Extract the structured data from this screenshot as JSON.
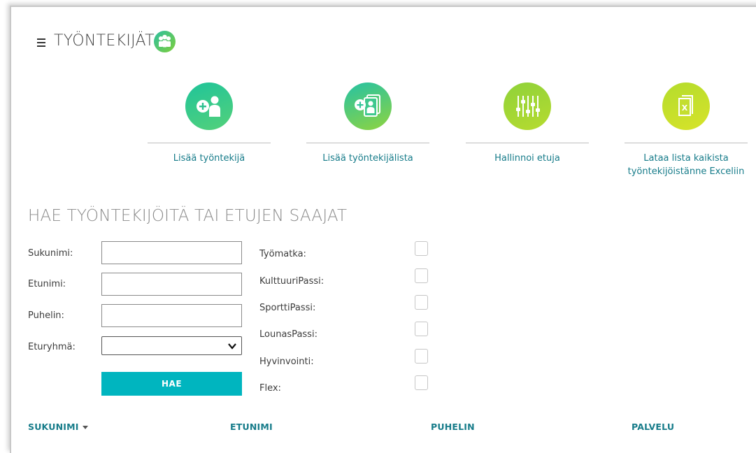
{
  "header": {
    "title": "TYÖNTEKIJÄT",
    "menu_icon": "hamburger-icon",
    "title_icon": "people-group-icon"
  },
  "actions": [
    {
      "label": "Lisää työntekijä",
      "icon": "add-person-icon"
    },
    {
      "label": "Lisää työntekijälista",
      "icon": "add-person-list-icon"
    },
    {
      "label": "Hallinnoi etuja",
      "icon": "sliders-icon"
    },
    {
      "label": "Lataa lista kaikista työntekijöistänne Exceliin",
      "icon": "excel-file-icon"
    }
  ],
  "search": {
    "heading": "HAE TYÖNTEKIJÖITÄ TAI ETUJEN SAAJAT",
    "fields": {
      "sukunimi": {
        "label": "Sukunimi:",
        "value": ""
      },
      "etunimi": {
        "label": "Etunimi:",
        "value": ""
      },
      "puhelin": {
        "label": "Puhelin:",
        "value": ""
      },
      "eturyhma": {
        "label": "Eturyhmä:",
        "value": ""
      }
    },
    "button_label": "HAE",
    "checkboxes": [
      {
        "label": "Työmatka:",
        "checked": false
      },
      {
        "label": "KulttuuriPassi:",
        "checked": false
      },
      {
        "label": "SporttiPassi:",
        "checked": false
      },
      {
        "label": "LounasPassi:",
        "checked": false
      },
      {
        "label": "Hyvinvointi:",
        "checked": false
      },
      {
        "label": "Flex:",
        "checked": false
      }
    ]
  },
  "table": {
    "columns": [
      "SUKUNIMI",
      "ETUNIMI",
      "PUHELIN",
      "PALVELU"
    ],
    "sorted_column": "SUKUNIMI"
  },
  "colors": {
    "accent": "#00b5bf",
    "link": "#177c8a",
    "gradient_start": "#1fc49a",
    "gradient_end": "#d7e32a"
  }
}
